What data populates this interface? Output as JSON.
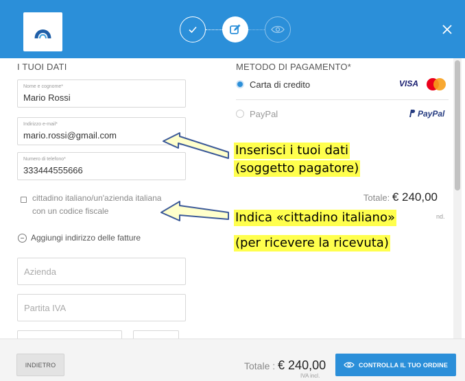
{
  "header": {
    "steps": [
      "check-icon",
      "edit-icon",
      "eye-icon"
    ],
    "close_icon": "close-icon",
    "accent": "#2b8fd9"
  },
  "personal": {
    "title": "I TUOI DATI",
    "name_label": "Nome e cognome*",
    "name_value": "Mario Rossi",
    "email_label": "Indirizzo e-mail*",
    "email_value": "mario.rossi@gmail.com",
    "phone_label": "Numero di telefono*",
    "phone_value": "333444555666",
    "citizen_label": "cittadino italiano/un'azienda italiana con un codice fiscale",
    "add_address": "Aggiungi indirizzo delle fatture",
    "company_placeholder": "Azienda",
    "vat_placeholder": "Partita IVA"
  },
  "payment": {
    "title": "METODO DI PAGAMENTO*",
    "options": [
      {
        "label": "Carta di credito",
        "selected": true,
        "brand": "VISA"
      },
      {
        "label": "PayPal",
        "selected": false,
        "brand": "PayPal"
      }
    ],
    "total_label": "Totale:",
    "total_value": "€ 240,00",
    "iva_note": "IVA incl."
  },
  "footer": {
    "back_label": "INDIETRO",
    "total_label": "Totale :",
    "total_value": "€ 240,00",
    "iva_label": "IVA incl.",
    "order_label": "CONTROLLA IL TUO ORDINE"
  },
  "annotations": {
    "data_line1": "Inserisci i tuoi dati",
    "data_line2": "(soggetto pagatore)",
    "citizen_line1": "Indica «cittadino italiano»",
    "citizen_line2": "(per ricevere la ricevuta)",
    "highlight_color": "#ffff4d"
  }
}
